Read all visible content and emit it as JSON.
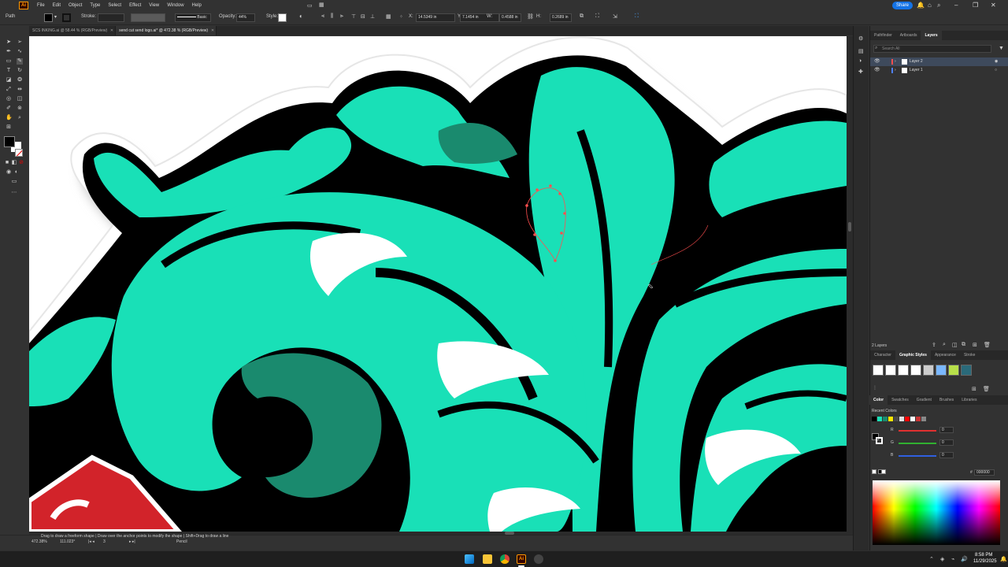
{
  "menu": {
    "items": [
      "File",
      "Edit",
      "Object",
      "Type",
      "Select",
      "Effect",
      "View",
      "Window",
      "Help"
    ],
    "share_label": "Share"
  },
  "control": {
    "object_type": "Path",
    "stroke_label": "Stroke:",
    "brush_label": "Basic",
    "opacity_label": "Opacity:",
    "opacity_value": "44%",
    "style_label": "Style:",
    "x_label": "X:",
    "x_value": "14.5349 in",
    "y_label": "Y:",
    "y_value": "7.1454 in",
    "w_label": "W:",
    "w_value": "0.4588 in",
    "h_label": "H:",
    "h_value": "0.2689 in"
  },
  "tabs": [
    {
      "label": "SCS INKING.ai @ 58.44 % (RGB/Preview)",
      "active": false
    },
    {
      "label": "send cut send logo.ai* @ 472.38 % (RGB/Preview)",
      "active": true
    }
  ],
  "status": {
    "zoom": "472.38%",
    "rotation": "111.023°",
    "artboard": "3",
    "tool": "Pencil",
    "hint": "Drag to draw a freeform shape  |  Draw over the anchor points to modify the shape  |  Shift+Drag to draw a line"
  },
  "layers_panel": {
    "tabs": [
      "Pathfinder",
      "Artboards",
      "Layers"
    ],
    "active_tab": "Layers",
    "search_placeholder": "Search All",
    "layers": [
      {
        "name": "Layer 2",
        "color": "#ff4f4f",
        "selected": true
      },
      {
        "name": "Layer 1",
        "color": "#4f7fff",
        "selected": false
      }
    ],
    "count_label": "2 Layers"
  },
  "styles_panel": {
    "tabs": [
      "Character",
      "Graphic Styles",
      "Appearance",
      "Stroke"
    ],
    "active_tab": "Graphic Styles"
  },
  "color_panel": {
    "tabs": [
      "Color",
      "Swatches",
      "Gradient",
      "Brushes",
      "Libraries"
    ],
    "active_tab": "Color",
    "recent_label": "Recent Colors",
    "recent_colors": [
      "#000000",
      "#19e0b7",
      "#1a8a6e",
      "#ffe600",
      "#4a4a4a",
      "#e0e0e0",
      "#ff0000",
      "#ffffff",
      "#c83232",
      "#888888"
    ],
    "channels": [
      {
        "label": "R",
        "value": "0",
        "color": "#e03030"
      },
      {
        "label": "G",
        "value": "0",
        "color": "#30b030"
      },
      {
        "label": "B",
        "value": "0",
        "color": "#3060e0"
      }
    ],
    "hex_value": "000000"
  },
  "taskbar": {
    "time": "8:58 PM",
    "date": "11/29/2025"
  }
}
